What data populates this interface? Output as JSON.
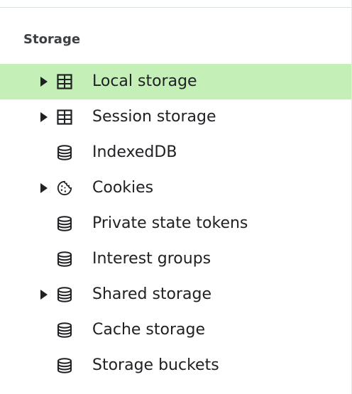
{
  "section": {
    "title": "Storage"
  },
  "items": [
    {
      "label": "Local storage",
      "icon": "table-icon",
      "expandable": true,
      "selected": true
    },
    {
      "label": "Session storage",
      "icon": "table-icon",
      "expandable": true,
      "selected": false
    },
    {
      "label": "IndexedDB",
      "icon": "database-icon",
      "expandable": false,
      "selected": false
    },
    {
      "label": "Cookies",
      "icon": "cookie-icon",
      "expandable": true,
      "selected": false
    },
    {
      "label": "Private state tokens",
      "icon": "database-icon",
      "expandable": false,
      "selected": false
    },
    {
      "label": "Interest groups",
      "icon": "database-icon",
      "expandable": false,
      "selected": false
    },
    {
      "label": "Shared storage",
      "icon": "database-icon",
      "expandable": true,
      "selected": false
    },
    {
      "label": "Cache storage",
      "icon": "database-icon",
      "expandable": false,
      "selected": false
    },
    {
      "label": "Storage buckets",
      "icon": "database-icon",
      "expandable": false,
      "selected": false
    }
  ],
  "colors": {
    "selected_background": "#c4f0b8",
    "text": "#202124"
  }
}
